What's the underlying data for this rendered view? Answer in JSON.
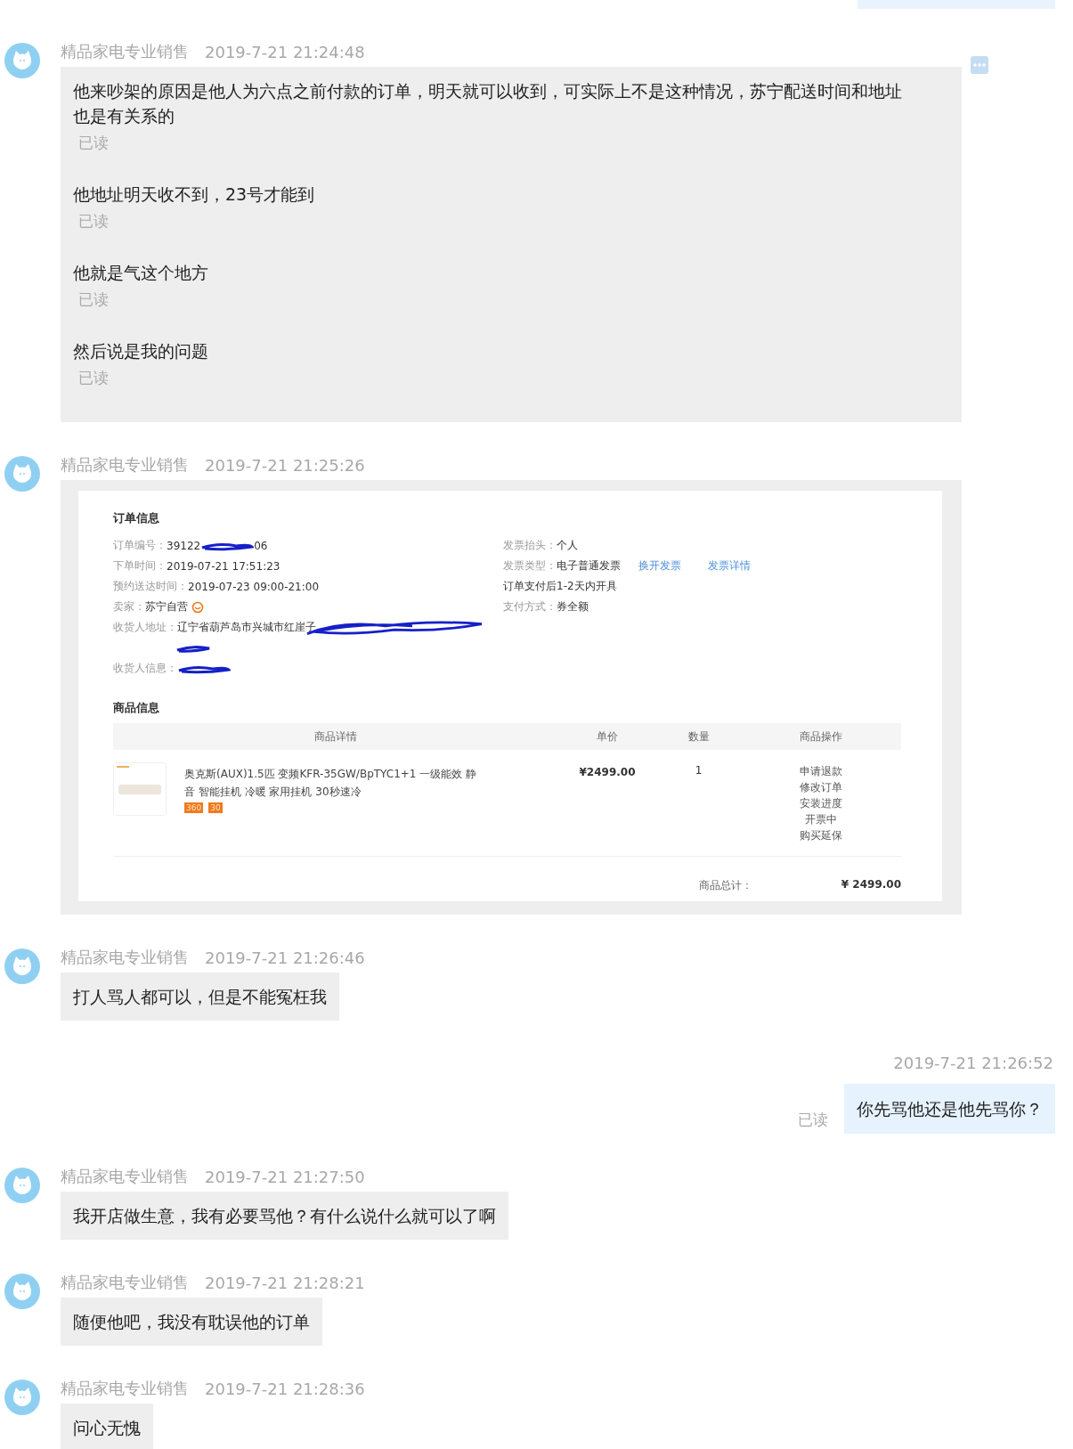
{
  "messages": [
    {
      "kind": "received_text",
      "sender": "精品家电专业销售",
      "time": "2019-7-21 21:24:48",
      "more_menu": true,
      "parts": [
        {
          "text": "他来吵架的原因是他人为六点之前付款的订单，明天就可以收到，可实际上不是这种情况，苏宁配送时间和地址也是有关系的",
          "read_mark": "已读"
        },
        {
          "text": "他地址明天收不到，23号才能到",
          "read_mark": "已读"
        },
        {
          "text": "他就是气这个地方",
          "read_mark": "已读"
        },
        {
          "text": "然后说是我的问题",
          "read_mark": "已读"
        }
      ]
    },
    {
      "kind": "order",
      "sender": "精品家电专业销售",
      "time": "2019-7-21 21:25:26",
      "more_menu": false,
      "order": {
        "section_title": "订单信息",
        "left_fields": [
          {
            "label": "订单编号：",
            "value": "39122",
            "redacted": true,
            "value_after": "06"
          },
          {
            "label": "下单时间：",
            "value": "2019-07-21 17:51:23",
            "redacted": false
          },
          {
            "label": "预约送达时间：",
            "value": "2019-07-23 09:00-21:00",
            "redacted": false
          },
          {
            "label": "卖家：",
            "value": "苏宁自营",
            "badge": true,
            "redacted": false
          },
          {
            "label": "收货人地址：",
            "value": "辽宁省葫芦岛市兴城市红崖子",
            "redacted": true,
            "second_line_redacted": true
          },
          {
            "label": "收货人信息：",
            "redacted": true
          }
        ],
        "right_fields": [
          {
            "label": "发票抬头：",
            "value": "个人"
          },
          {
            "label": "发票类型：",
            "value": "电子普通发票",
            "links": [
              "换开发票",
              "发票详情"
            ]
          },
          {
            "value": "订单支付后1-2天内开具"
          },
          {
            "label": "支付方式：",
            "value": "券全额"
          }
        ],
        "goods_title": "商品信息",
        "columns": [
          "商品详情",
          "单价",
          "数量",
          "商品操作"
        ],
        "item": {
          "name": "奥克斯(AUX)1.5匹 变频KFR-35GW/BpTYC1+1 一级能效 静音 智能挂机 冷暖 家用挂机 30秒速冷",
          "tags": [
            "360",
            "30"
          ],
          "price": "¥2499.00",
          "quantity": "1",
          "actions": [
            "申请退款",
            "修改订单",
            "安装进度",
            "开票中",
            "购买延保"
          ]
        },
        "total_label": "商品总计：",
        "total": "¥ 2499.00"
      }
    },
    {
      "kind": "received_text",
      "sender": "精品家电专业销售",
      "time": "2019-7-21 21:26:46",
      "more_menu": false,
      "parts": [
        {
          "text": "打人骂人都可以，但是不能冤枉我"
        }
      ]
    },
    {
      "kind": "sent_text",
      "time": "2019-7-21 21:26:52",
      "read_mark": "已读",
      "parts": [
        {
          "text": "你先骂他还是他先骂你？"
        }
      ]
    },
    {
      "kind": "received_text",
      "sender": "精品家电专业销售",
      "time": "2019-7-21 21:27:50",
      "more_menu": false,
      "parts": [
        {
          "text": "我开店做生意，我有必要骂他？有什么说什么就可以了啊"
        }
      ]
    },
    {
      "kind": "received_text",
      "sender": "精品家电专业销售",
      "time": "2019-7-21 21:28:21",
      "more_menu": false,
      "parts": [
        {
          "text": "随便他吧，我没有耽误他的订单"
        }
      ]
    },
    {
      "kind": "received_text",
      "sender": "精品家电专业销售",
      "time": "2019-7-21 21:28:36",
      "more_menu": false,
      "parts": [
        {
          "text": "问心无愧"
        }
      ]
    }
  ]
}
